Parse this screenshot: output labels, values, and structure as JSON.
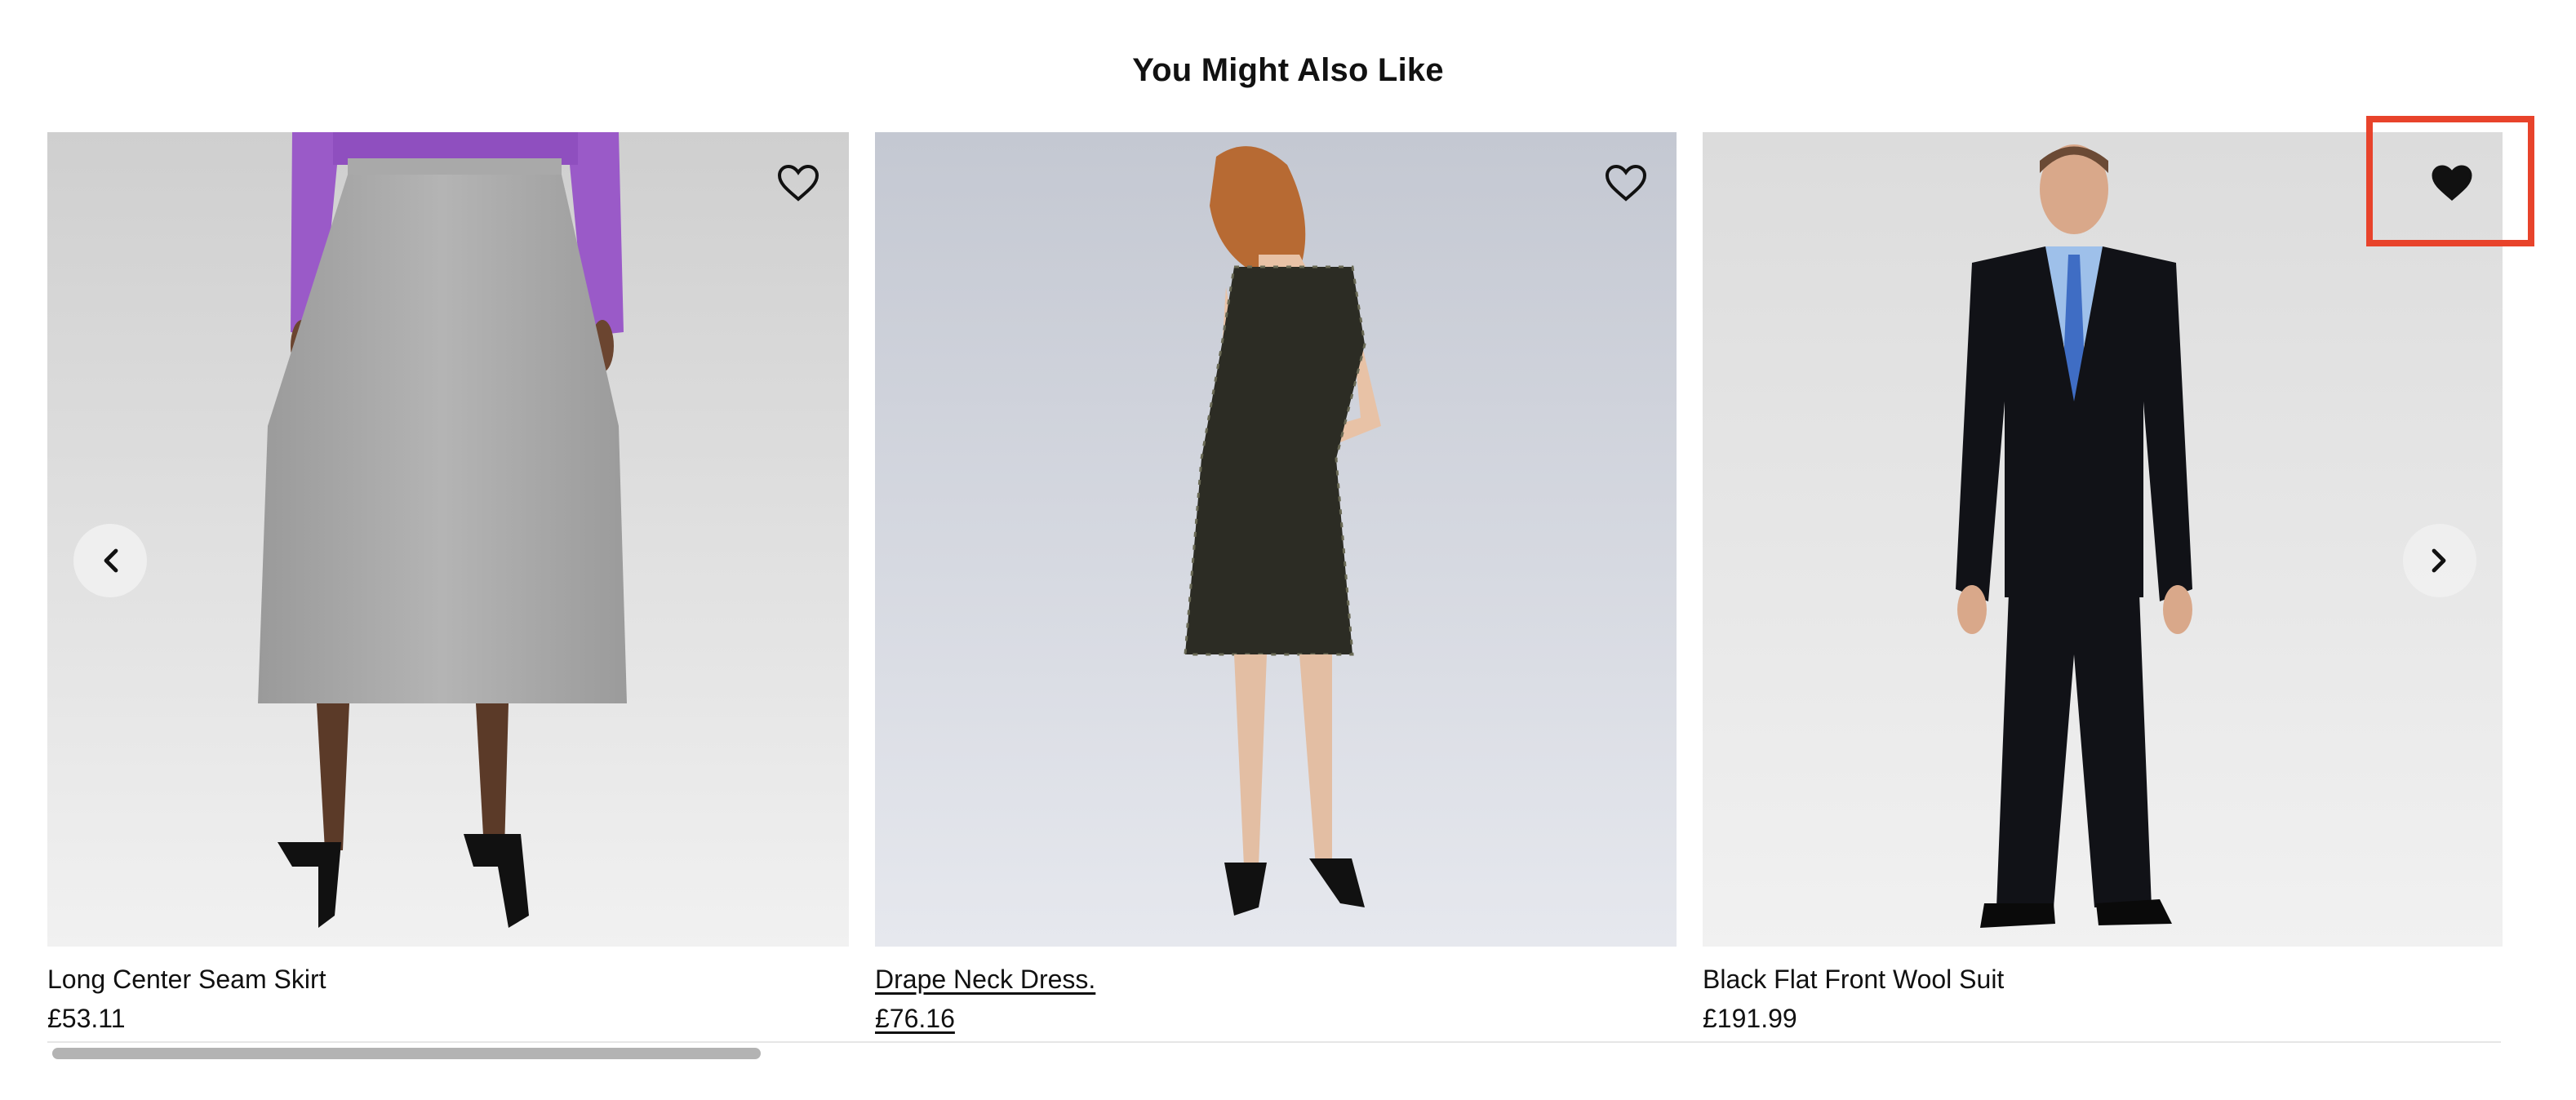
{
  "section": {
    "title": "You Might Also Like"
  },
  "products": [
    {
      "name": "Long Center Seam Skirt",
      "price": "£53.11",
      "favorited": false
    },
    {
      "name": "Drape Neck Dress.",
      "price": "£76.16",
      "favorited": false
    },
    {
      "name": "Black Flat Front Wool Suit",
      "price": "£191.99",
      "favorited": true
    }
  ],
  "icons": {
    "favorite_empty": "heart-outline-icon",
    "favorite_filled": "heart-filled-icon",
    "prev": "chevron-left-icon",
    "next": "chevron-right-icon"
  },
  "colors": {
    "highlight": "#e8432b",
    "text": "#111111",
    "scroll_thumb": "#b3b3b3"
  },
  "scrollbar": {
    "position_fraction": 0.29
  }
}
